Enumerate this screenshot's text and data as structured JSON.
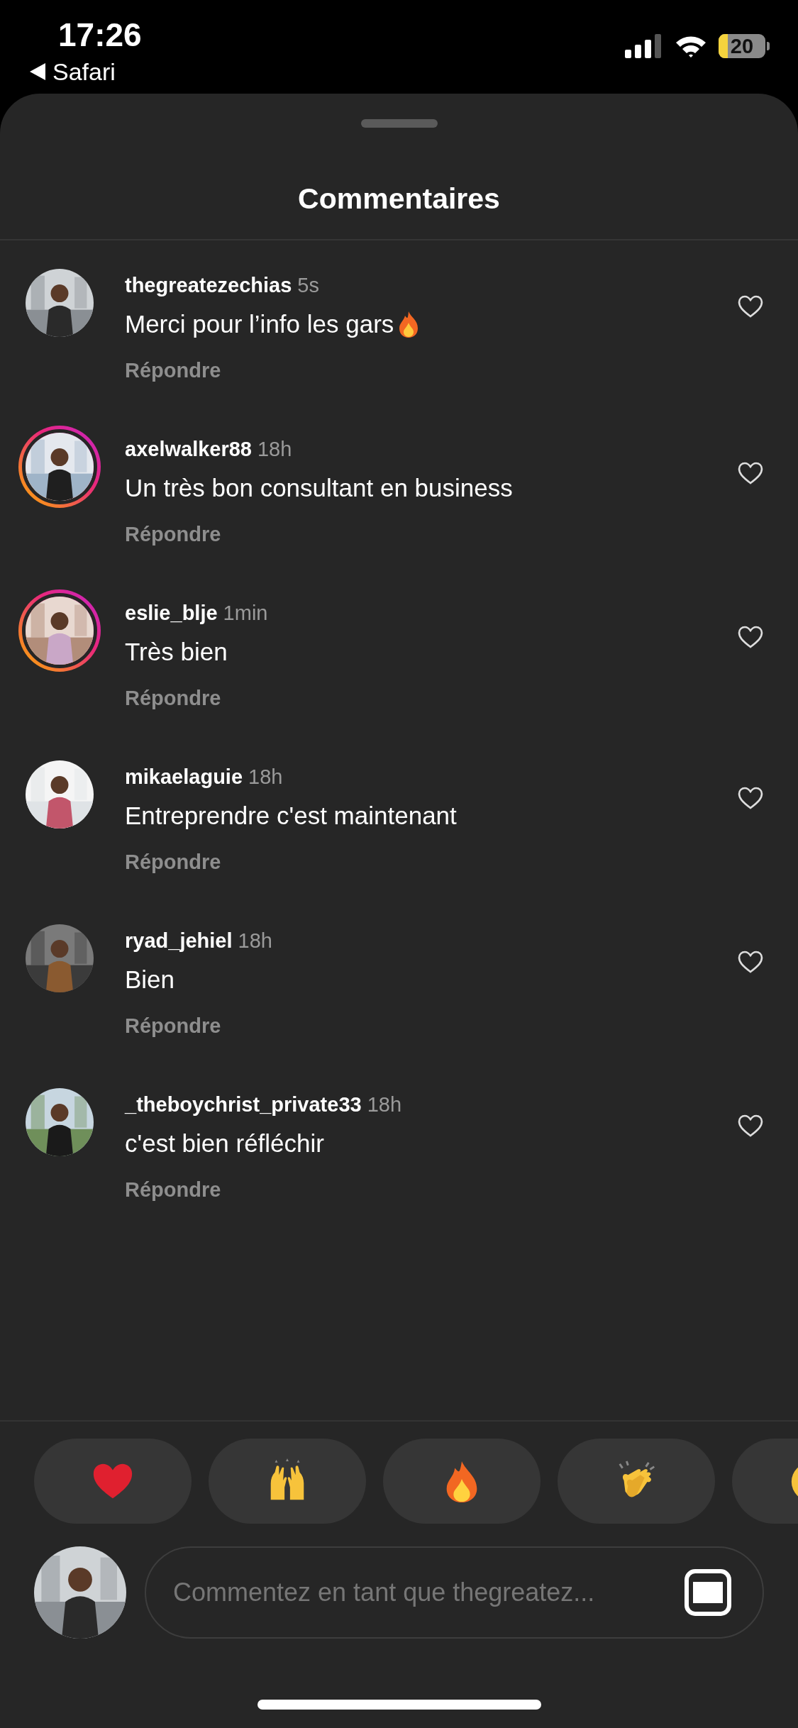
{
  "status_bar": {
    "time": "17:26",
    "back_label": "Safari",
    "battery": "20"
  },
  "sheet": {
    "title": "Commentaires"
  },
  "comments": [
    {
      "username": "thegreatezechias",
      "time": "5s",
      "text": "Merci pour l’info les gars",
      "trailing_emoji": true,
      "story_ring": false,
      "reply": "Répondre",
      "liked": false
    },
    {
      "username": "axelwalker88",
      "time": "18h",
      "text": "Un très bon consultant en business",
      "trailing_emoji": false,
      "story_ring": true,
      "reply": "Répondre",
      "liked": false
    },
    {
      "username": "eslie_blje",
      "time": "1min",
      "text": "Très bien",
      "trailing_emoji": false,
      "story_ring": true,
      "reply": "Répondre",
      "liked": false
    },
    {
      "username": "mikaelaguie",
      "time": "18h",
      "text": "Entreprendre c'est maintenant",
      "trailing_emoji": false,
      "story_ring": false,
      "reply": "Répondre",
      "liked": false
    },
    {
      "username": "ryad_jehiel",
      "time": "18h",
      "text": "Bien",
      "trailing_emoji": false,
      "story_ring": false,
      "reply": "Répondre",
      "liked": false
    },
    {
      "username": "_theboychrist_private33",
      "time": "18h",
      "text": "c'est bien réfléchir",
      "trailing_emoji": false,
      "story_ring": false,
      "reply": "Répondre",
      "liked": false
    }
  ],
  "composer": {
    "placeholder": "Commentez en tant que thegreatez..."
  }
}
